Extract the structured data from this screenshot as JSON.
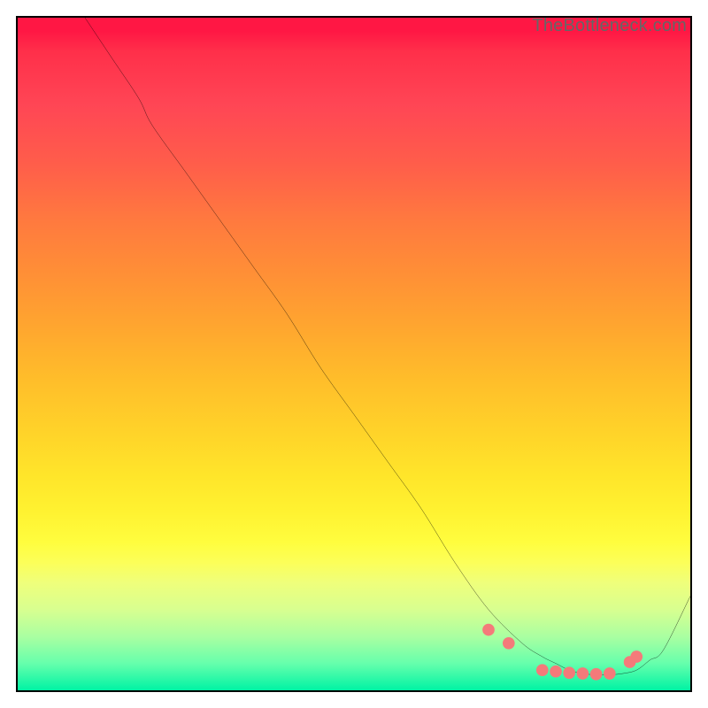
{
  "watermark": "TheBottleneck.com",
  "chart_data": {
    "type": "line",
    "title": "",
    "xlabel": "",
    "ylabel": "",
    "xlim": [
      0,
      100
    ],
    "ylim": [
      0,
      100
    ],
    "curve": {
      "name": "bottleneck-curve",
      "x": [
        10,
        14,
        18,
        20,
        25,
        30,
        35,
        40,
        45,
        50,
        55,
        60,
        65,
        70,
        75,
        78,
        80,
        82,
        84,
        86,
        88,
        90,
        92,
        94,
        96,
        100
      ],
      "y": [
        100,
        94,
        88,
        84,
        77,
        70,
        63,
        56,
        48,
        41,
        34,
        27,
        19,
        12,
        7,
        5,
        4,
        3,
        2.5,
        2.3,
        2.3,
        2.5,
        3,
        4.5,
        6,
        14
      ]
    },
    "markers": {
      "name": "highlight-dots",
      "x": [
        70,
        73,
        78,
        80,
        82,
        84,
        86,
        88,
        91,
        92
      ],
      "y": [
        9,
        7,
        3,
        2.8,
        2.6,
        2.5,
        2.4,
        2.5,
        4.2,
        5
      ]
    },
    "colors": {
      "curve": "#000000",
      "markers": "#f47a7a",
      "gradient_top": "#ff1744",
      "gradient_mid": "#ffe52a",
      "gradient_bottom": "#00f3a4"
    }
  }
}
